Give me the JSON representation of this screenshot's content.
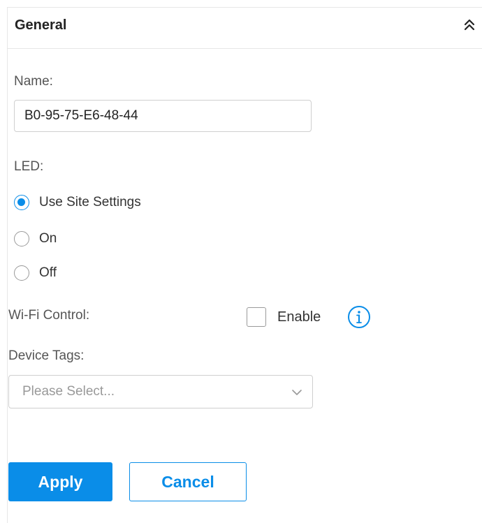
{
  "section": {
    "title": "General",
    "collapse_icon": "double-chevron-up-icon"
  },
  "name_field": {
    "label": "Name:",
    "value": "B0-95-75-E6-48-44"
  },
  "led": {
    "label": "LED:",
    "options": [
      {
        "label": "Use Site Settings",
        "checked": true
      },
      {
        "label": "On",
        "checked": false
      },
      {
        "label": "Off",
        "checked": false
      }
    ]
  },
  "wifi_control": {
    "label": "Wi-Fi Control:",
    "checkbox_label": "Enable",
    "checked": false,
    "info_icon": "info-circle-icon"
  },
  "device_tags": {
    "label": "Device Tags:",
    "placeholder": "Please Select..."
  },
  "actions": {
    "apply_label": "Apply",
    "cancel_label": "Cancel"
  },
  "colors": {
    "accent": "#0a8de8",
    "border": "#cfcfcf",
    "divider": "#e6e6e6"
  }
}
